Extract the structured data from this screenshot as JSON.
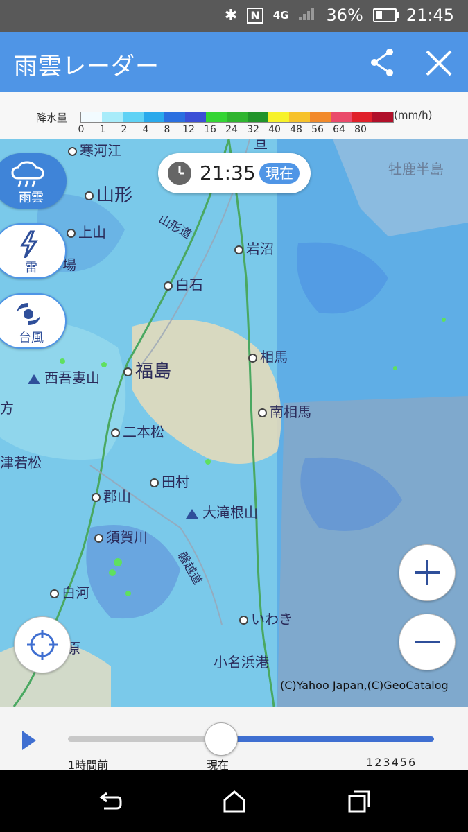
{
  "status_bar": {
    "network": "4G",
    "battery": "36%",
    "battery_fraction": 0.36,
    "time": "21:45"
  },
  "app_bar": {
    "title": "雨雲レーダー"
  },
  "legend": {
    "label": "降水量",
    "unit": "(mm/h)",
    "ticks": [
      "0",
      "1",
      "2",
      "4",
      "8",
      "12",
      "16",
      "24",
      "32",
      "40",
      "48",
      "56",
      "64",
      "80"
    ],
    "colors": [
      "#f2fbff",
      "#a8ecfa",
      "#5fd2f5",
      "#29a9ec",
      "#2a6fe0",
      "#3b4fd6",
      "#34d534",
      "#2fb52f",
      "#21942a",
      "#f7f22a",
      "#f7c22a",
      "#f28a2a",
      "#ea4a6a",
      "#e0202a",
      "#b0102a"
    ]
  },
  "map": {
    "time": "21:35",
    "now_badge": "現在",
    "cities": [
      {
        "name": "寒河江",
        "type": "city"
      },
      {
        "name": "山形",
        "type": "big"
      },
      {
        "name": "上山",
        "type": "city"
      },
      {
        "name": "岩沼",
        "type": "city"
      },
      {
        "name": "白石",
        "type": "city"
      },
      {
        "name": "相馬",
        "type": "city"
      },
      {
        "name": "福島",
        "type": "big"
      },
      {
        "name": "南相馬",
        "type": "city"
      },
      {
        "name": "西吾妻山",
        "type": "mountain"
      },
      {
        "name": "二本松",
        "type": "city"
      },
      {
        "name": "田村",
        "type": "city"
      },
      {
        "name": "大滝根山",
        "type": "mountain"
      },
      {
        "name": "郡山",
        "type": "city"
      },
      {
        "name": "須賀川",
        "type": "city"
      },
      {
        "name": "白河",
        "type": "city"
      },
      {
        "name": "いわき",
        "type": "city"
      },
      {
        "name": "小名浜港",
        "type": "plain"
      },
      {
        "name": "牡鹿半島",
        "type": "plain"
      },
      {
        "name": "方",
        "type": "plain"
      },
      {
        "name": "津若松",
        "type": "plain"
      },
      {
        "name": "原",
        "type": "plain"
      },
      {
        "name": "場",
        "type": "plain"
      },
      {
        "name": "亘",
        "type": "plain"
      }
    ],
    "roads": [
      "山形道",
      "磐越道"
    ],
    "copyright": "(C)Yahoo Japan,(C)GeoCatalog"
  },
  "side_buttons": [
    {
      "label": "雨雲",
      "icon": "rain-cloud-icon",
      "active": true
    },
    {
      "label": "雷",
      "icon": "lightning-icon",
      "active": false
    },
    {
      "label": "台風",
      "icon": "typhoon-icon",
      "active": false
    }
  ],
  "slider": {
    "past_label": "1時間前",
    "now_label": "現在",
    "future_labels": [
      "1",
      "2",
      "3",
      "4",
      "5",
      "6"
    ],
    "position_fraction": 0.41
  }
}
